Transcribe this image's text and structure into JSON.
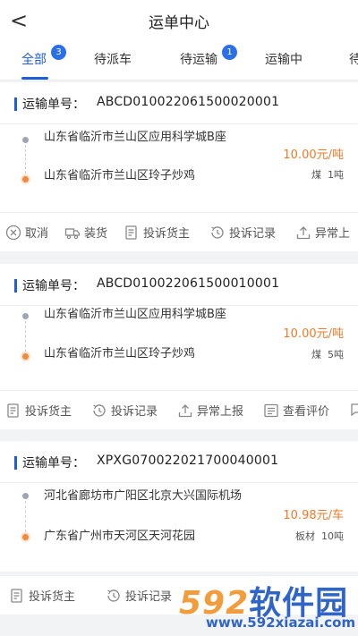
{
  "header": {
    "back_glyph": "<",
    "title": "运单中心"
  },
  "tabs": [
    {
      "label": "全部",
      "badge": "3",
      "active": true
    },
    {
      "label": "待派车",
      "badge": ""
    },
    {
      "label": "待运输",
      "badge": "1"
    },
    {
      "label": "运输中",
      "badge": ""
    },
    {
      "label": "待",
      "badge": ""
    }
  ],
  "orders": [
    {
      "number_label": "运输单号：",
      "number": "ABCD010022061500020001",
      "from": "山东省临沂市兰山区应用科学城B座",
      "to": "山东省临沂市兰山区玲子炒鸡",
      "price": "10.00元/吨",
      "cargo": "煤",
      "weight": "1吨",
      "actions": [
        "取消",
        "装货",
        "投诉货主",
        "投诉记录",
        "异常上"
      ]
    },
    {
      "number_label": "运输单号：",
      "number": "ABCD010022061500010001",
      "from": "山东省临沂市兰山区应用科学城B座",
      "to": "山东省临沂市兰山区玲子炒鸡",
      "price": "10.00元/吨",
      "cargo": "煤",
      "weight": "5吨",
      "actions": [
        "投诉货主",
        "投诉记录",
        "异常上报",
        "查看评价"
      ]
    },
    {
      "number_label": "运输单号：",
      "number": "XPXG070022021700040001",
      "from": "河北省廊坊市广阳区北京大兴国际机场",
      "to": "广东省广州市天河区天河花园",
      "price": "10.98元/车",
      "cargo": "板材",
      "weight": "10吨",
      "actions": [
        "投诉货主",
        "投诉记录"
      ]
    }
  ],
  "watermark": {
    "brand_num": "592",
    "brand_cn": "软件园",
    "url": "www.592xiazai.com"
  },
  "colors": {
    "accent": "#1f5ed6",
    "price": "#f07a28",
    "badge": "#2a6ee8",
    "end_dot": "#f08a3c"
  }
}
